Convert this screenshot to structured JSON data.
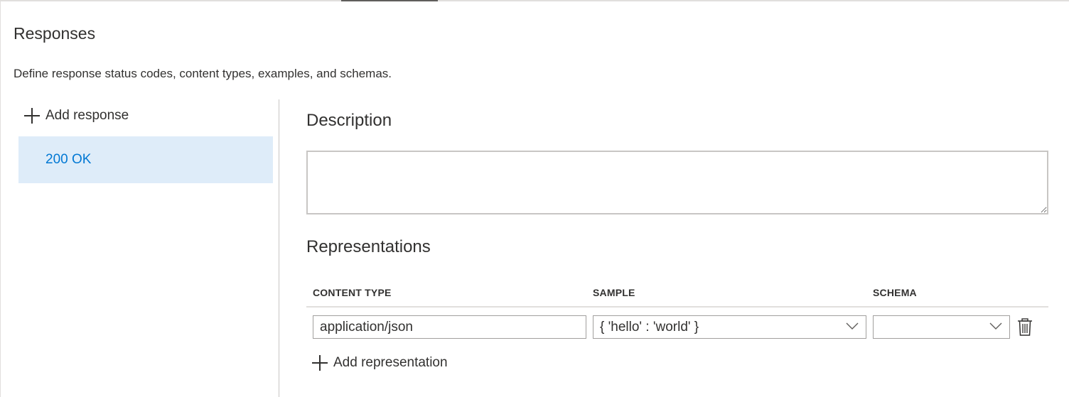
{
  "section": {
    "title": "Responses",
    "description": "Define response status codes, content types, examples, and schemas."
  },
  "left_pane": {
    "add_response_label": "Add response",
    "responses": [
      {
        "label": "200 OK",
        "selected": true
      }
    ]
  },
  "right_pane": {
    "description_title": "Description",
    "description_value": "",
    "representations_title": "Representations",
    "columns": {
      "content_type": "CONTENT TYPE",
      "sample": "SAMPLE",
      "schema": "SCHEMA"
    },
    "rows": [
      {
        "content_type": "application/json",
        "sample": "{ 'hello' : 'world' }",
        "schema": ""
      }
    ],
    "add_representation_label": "Add representation"
  },
  "colors": {
    "accent": "#0078d4",
    "selected_bg": "#deecf9",
    "border": "#c8c6c4"
  },
  "icons": {
    "add": "plus-icon",
    "dropdown": "chevron-down-icon",
    "delete": "trash-icon"
  }
}
